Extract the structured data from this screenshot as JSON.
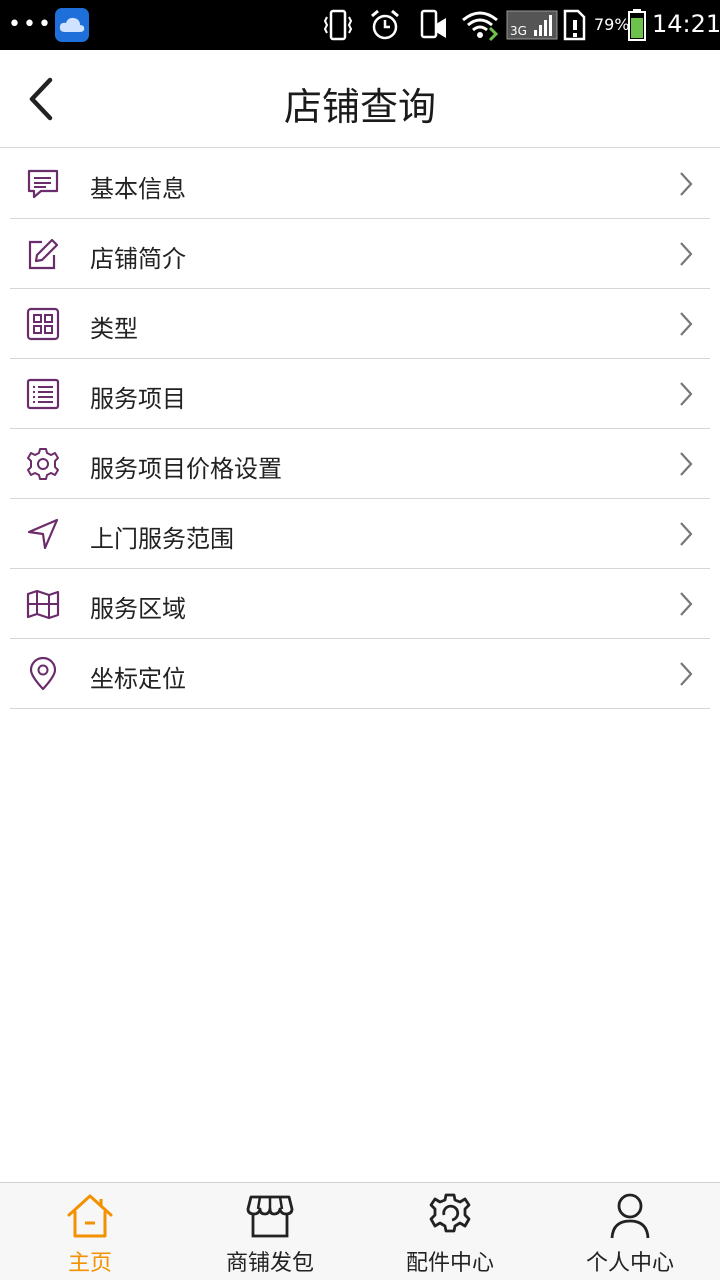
{
  "status_bar": {
    "battery_percent": "79%",
    "time": "14:21",
    "network": "3G",
    "icons": [
      "cloud-app-icon",
      "vibrate-icon",
      "alarm-icon",
      "phone-alert-icon",
      "wifi-icon",
      "signal-icon",
      "sim-alert-icon",
      "battery-icon"
    ]
  },
  "header": {
    "title": "店铺查询",
    "back_icon": "chevron-left-icon"
  },
  "menu": {
    "items": [
      {
        "label": "基本信息",
        "icon": "message-lines-icon"
      },
      {
        "label": "店铺简介",
        "icon": "edit-icon"
      },
      {
        "label": "类型",
        "icon": "grid-icon"
      },
      {
        "label": "服务项目",
        "icon": "list-icon"
      },
      {
        "label": "服务项目价格设置",
        "icon": "gear-icon"
      },
      {
        "label": "上门服务范围",
        "icon": "navigation-arrow-icon"
      },
      {
        "label": "服务区域",
        "icon": "map-icon"
      },
      {
        "label": "坐标定位",
        "icon": "location-pin-icon"
      }
    ],
    "icon_color": "#6b2c6b"
  },
  "bottom_nav": {
    "items": [
      {
        "label": "主页",
        "icon": "home-icon",
        "active": true
      },
      {
        "label": "商铺发包",
        "icon": "store-icon",
        "active": false
      },
      {
        "label": "配件中心",
        "icon": "cog-part-icon",
        "active": false
      },
      {
        "label": "个人中心",
        "icon": "person-icon",
        "active": false
      }
    ],
    "active_color": "#f39200"
  }
}
